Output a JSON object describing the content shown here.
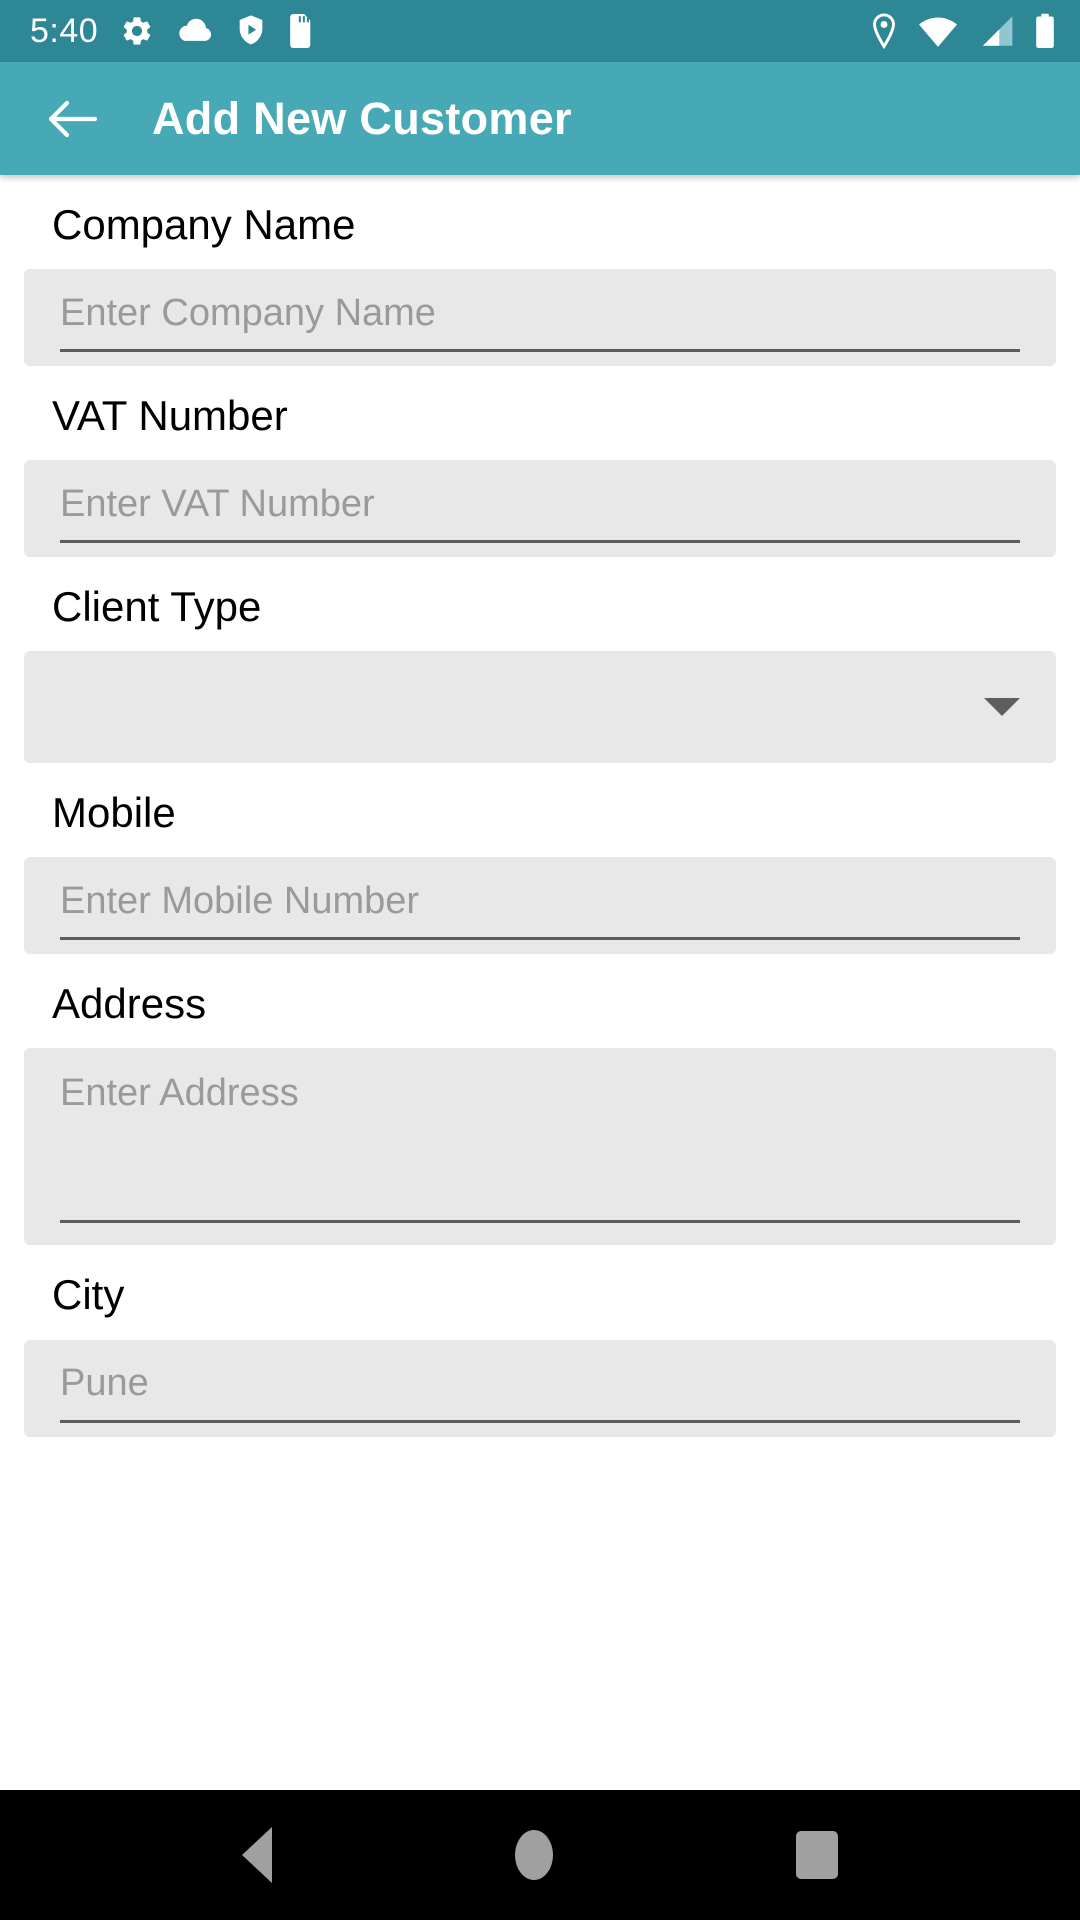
{
  "statusbar": {
    "time": "5:40",
    "left_icons": [
      "gear-icon",
      "cloud-icon",
      "shield-play-icon",
      "sd-card-icon"
    ],
    "right_icons": [
      "location-pin-icon",
      "wifi-icon",
      "signal-bars-icon",
      "battery-icon"
    ],
    "background": "#2E8795"
  },
  "appbar": {
    "back_icon": "back-arrow-icon",
    "title": "Add New Customer",
    "background": "#47A9B6"
  },
  "form": {
    "fields": [
      {
        "label": "Company Name",
        "placeholder": "Enter Company Name",
        "value": "",
        "type": "text"
      },
      {
        "label": "VAT Number",
        "placeholder": "Enter VAT Number",
        "value": "",
        "type": "text"
      },
      {
        "label": "Client Type",
        "placeholder": "",
        "value": "",
        "type": "dropdown"
      },
      {
        "label": "Mobile",
        "placeholder": "Enter Mobile Number",
        "value": "",
        "type": "text"
      },
      {
        "label": "Address",
        "placeholder": "Enter Address",
        "value": "",
        "type": "textarea"
      },
      {
        "label": "City",
        "placeholder": "Pune",
        "value": "",
        "type": "text"
      }
    ],
    "field_background": "#E8E8E8",
    "placeholder_color": "#9A9A9A",
    "underline_color": "#5C5C5C"
  },
  "navbar": {
    "back_label": "back-triangle-icon",
    "home_label": "home-circle-icon",
    "recents_label": "recents-square-icon",
    "background": "#000000"
  }
}
